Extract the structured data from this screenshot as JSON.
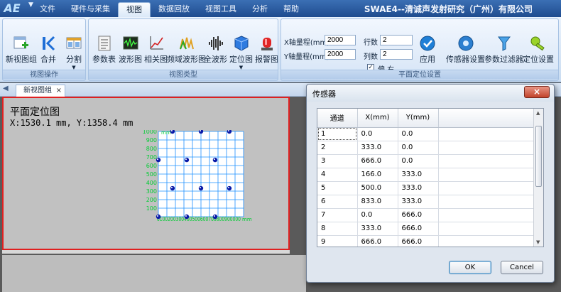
{
  "app": {
    "window_title": "SWAE4--清诚声发射研究（广州）有限公司",
    "logo_text": "AE"
  },
  "menu": [
    "文件",
    "硬件与采集",
    "视图",
    "数据回放",
    "视图工具",
    "分析",
    "帮助"
  ],
  "ribbon": {
    "view_ops": {
      "label": "视图操作",
      "buttons": [
        "新视图组",
        "合并",
        "分割"
      ]
    },
    "view_types": {
      "label": "视图类型",
      "buttons": [
        "参数表",
        "波形图",
        "相关图",
        "频域波形图",
        "全波形",
        "定位图",
        "报警图"
      ]
    },
    "planar": {
      "label": "平面定位设置",
      "x_range_label": "X轴量程(mm)",
      "x_range_value": "2000",
      "y_range_label": "Y轴量程(mm)",
      "y_range_value": "2000",
      "rows_label": "行数",
      "rows_value": "2",
      "cols_label": "列数",
      "cols_value": "2",
      "offset_label": "偏 右",
      "offset_checked": "✓",
      "apply_label": "应用"
    },
    "extra_buttons": [
      "传感器设置",
      "参数过滤器",
      "定位设置"
    ]
  },
  "tabs": {
    "doc_tab": "新视图组",
    "close_glyph": "×"
  },
  "view": {
    "title": "平面定位图",
    "coords": "X:1530.1 mm, Y:1358.4 mm",
    "y_ticks": [
      "1000",
      "900",
      "800",
      "700",
      "600",
      "500",
      "400",
      "300",
      "200",
      "100"
    ],
    "y_unit": "mm",
    "x_ticks_text": "0100200300400500600700800900000",
    "x_unit": "mm",
    "sensor_points": [
      [
        0,
        0
      ],
      [
        333,
        0
      ],
      [
        666,
        0
      ],
      [
        166,
        333
      ],
      [
        500,
        333
      ],
      [
        833,
        333
      ],
      [
        0,
        666
      ],
      [
        333,
        666
      ],
      [
        666,
        666
      ],
      [
        500,
        1000
      ],
      [
        833,
        1000
      ],
      [
        166,
        1000
      ]
    ]
  },
  "dialog": {
    "title": "传感器",
    "close_glyph": "×",
    "columns": [
      "通道",
      "X(mm)",
      "Y(mm)"
    ],
    "rows": [
      [
        "1",
        "0.0",
        "0.0"
      ],
      [
        "2",
        "333.0",
        "0.0"
      ],
      [
        "3",
        "666.0",
        "0.0"
      ],
      [
        "4",
        "166.0",
        "333.0"
      ],
      [
        "5",
        "500.0",
        "333.0"
      ],
      [
        "6",
        "833.0",
        "333.0"
      ],
      [
        "7",
        "0.0",
        "666.0"
      ],
      [
        "8",
        "333.0",
        "666.0"
      ],
      [
        "9",
        "666.0",
        "666.0"
      ]
    ],
    "ok_label": "OK",
    "cancel_label": "Cancel"
  },
  "colors": {
    "accent": "#1f4c8f",
    "plot_grid": "#1e90ff",
    "plot_labels": "#00cc33",
    "sensor_point": "#0a1aa8",
    "view_border": "#e02020"
  }
}
